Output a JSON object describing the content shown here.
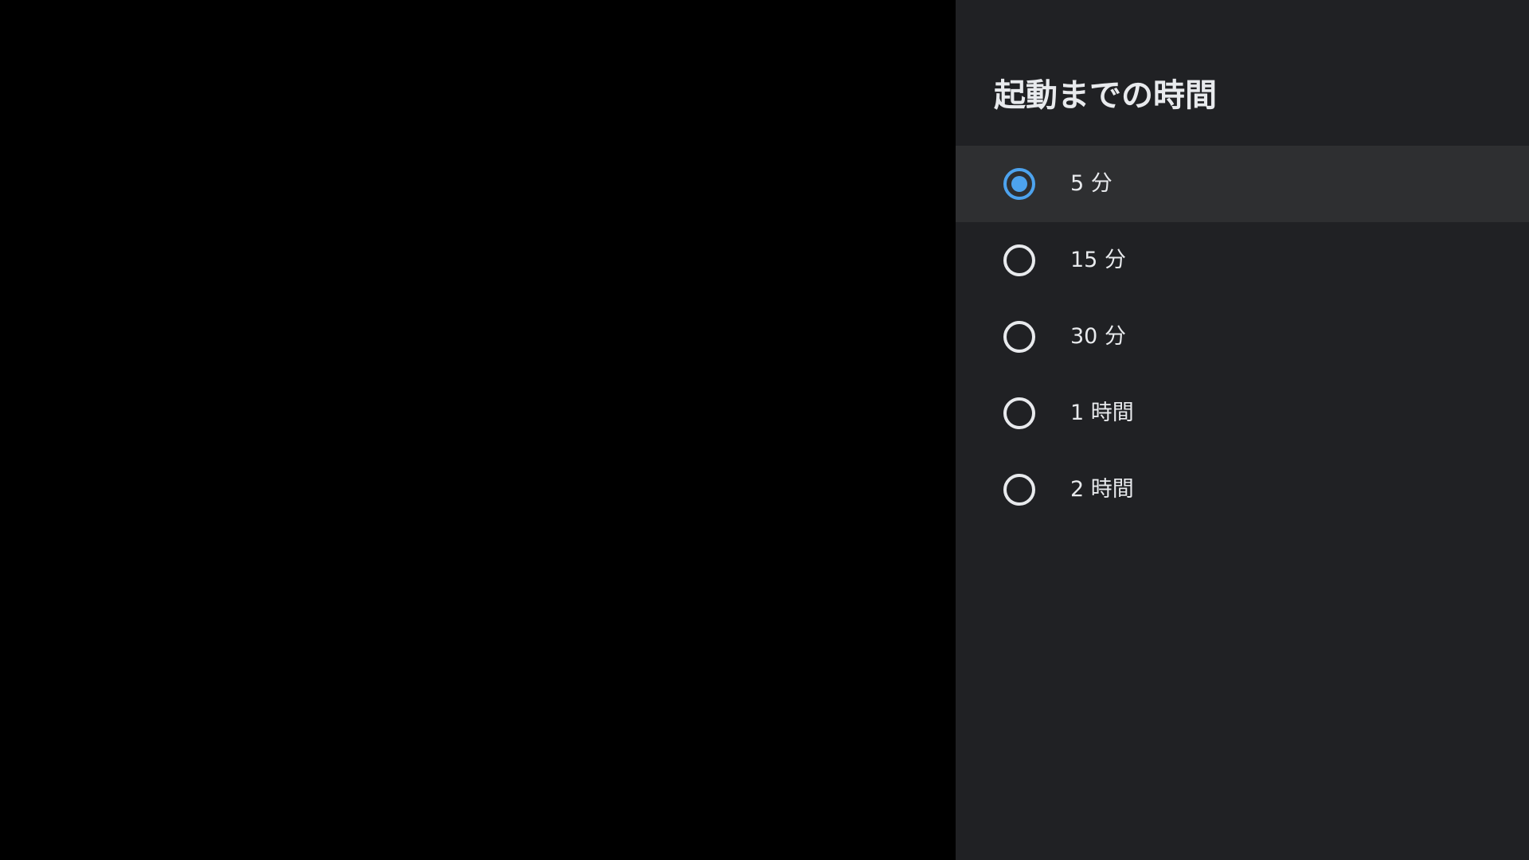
{
  "panel": {
    "title": "起動までの時間"
  },
  "options": [
    {
      "label": "5 分",
      "selected": true
    },
    {
      "label": "15 分",
      "selected": false
    },
    {
      "label": "30 分",
      "selected": false
    },
    {
      "label": "1 時間",
      "selected": false
    },
    {
      "label": "2 時間",
      "selected": false
    }
  ],
  "colors": {
    "accent": "#4da3ee",
    "panel_background": "#202124",
    "focused_row": "#2e2f31",
    "text": "#e8eaed",
    "background": "#000000"
  },
  "icons": {
    "selected": "radio-checked-icon",
    "unselected": "radio-unchecked-icon"
  }
}
